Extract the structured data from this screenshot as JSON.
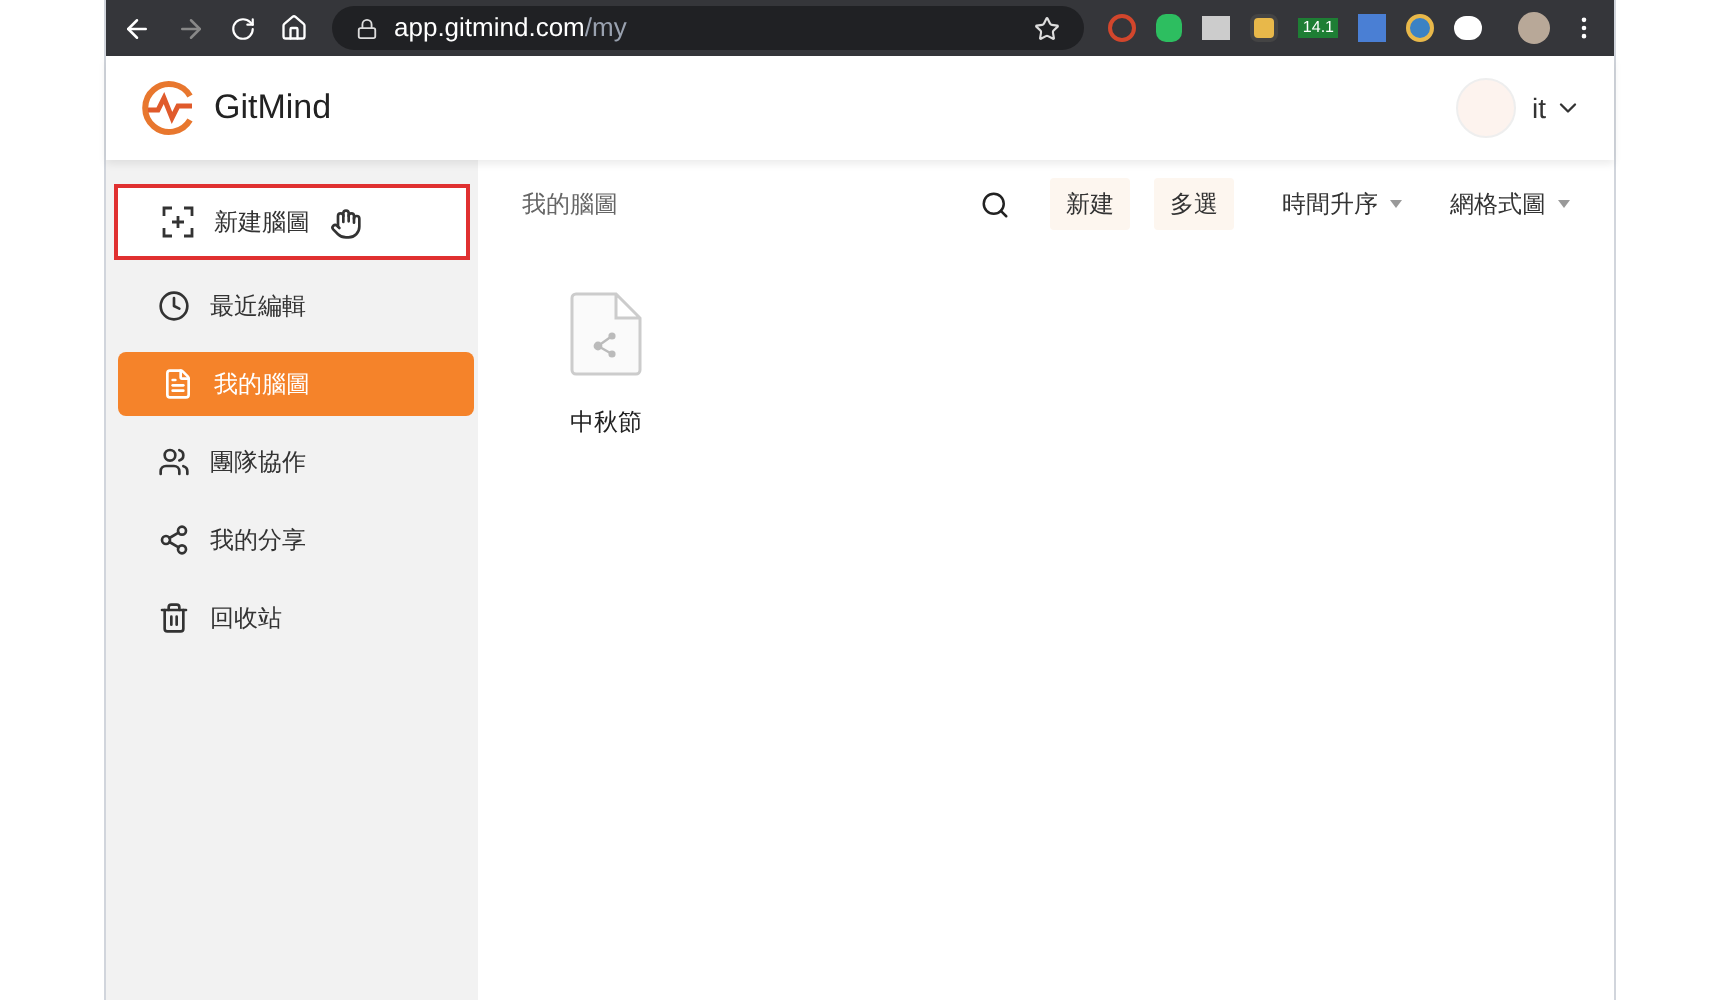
{
  "browser": {
    "url_host": "app.gitmind.com",
    "url_path": "/my",
    "extension_badge": "14.1"
  },
  "header": {
    "logo": "GitMind",
    "user": "it"
  },
  "sidebar": {
    "items": [
      {
        "label": "新建腦圖",
        "kind": "new",
        "selected": false,
        "outlined": true
      },
      {
        "label": "最近編輯",
        "kind": "recent",
        "selected": false,
        "outlined": false
      },
      {
        "label": "我的腦圖",
        "kind": "mine",
        "selected": true,
        "outlined": false
      },
      {
        "label": "團隊協作",
        "kind": "team",
        "selected": false,
        "outlined": false
      },
      {
        "label": "我的分享",
        "kind": "share",
        "selected": false,
        "outlined": false
      },
      {
        "label": "回收站",
        "kind": "trash",
        "selected": false,
        "outlined": false
      }
    ]
  },
  "toolbar": {
    "breadcrumb": "我的腦圖",
    "buttons": [
      "新建",
      "多選"
    ],
    "dropdowns": [
      "時間升序",
      "網格式圖"
    ]
  },
  "files": [
    {
      "name": "中秋節"
    }
  ]
}
